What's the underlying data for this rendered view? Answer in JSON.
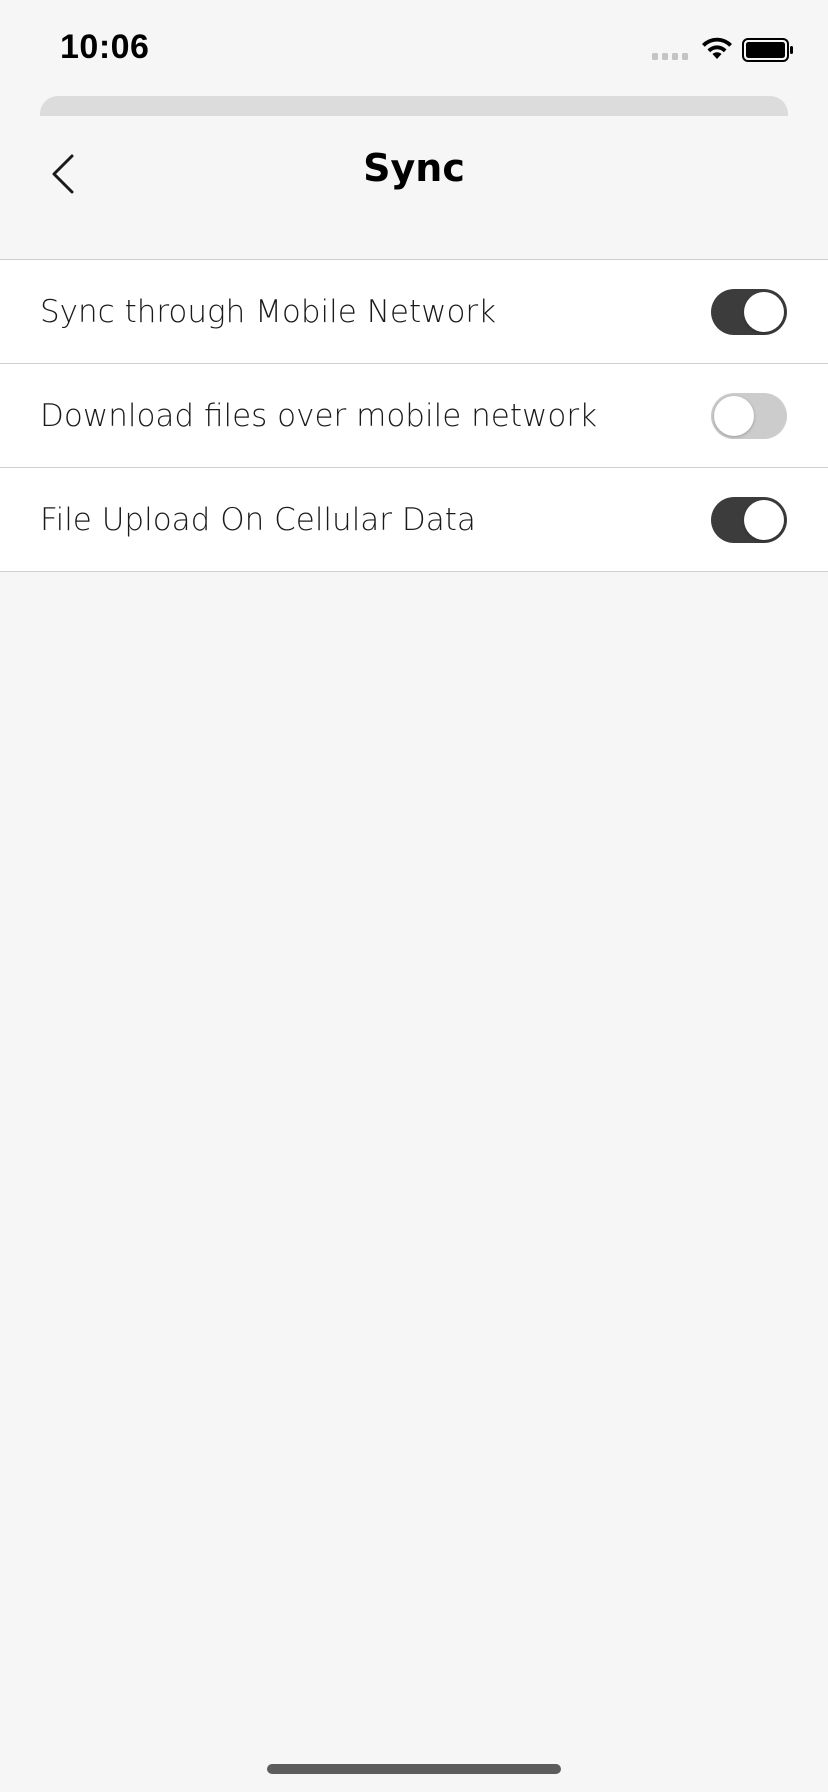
{
  "status_bar": {
    "time": "10:06",
    "signal_icon": "signal-dots-icon",
    "wifi_icon": "wifi-icon",
    "battery_icon": "battery-icon"
  },
  "nav": {
    "back_icon": "chevron-left-icon",
    "title": "Sync"
  },
  "settings": {
    "rows": [
      {
        "label": "Sync through Mobile Network",
        "enabled": true
      },
      {
        "label": "Download files over mobile network",
        "enabled": false
      },
      {
        "label": "File Upload On Cellular Data",
        "enabled": true
      }
    ]
  },
  "colors": {
    "background": "#f6f6f6",
    "toggle_on": "#3c3c3c",
    "toggle_off": "#cccccc"
  }
}
